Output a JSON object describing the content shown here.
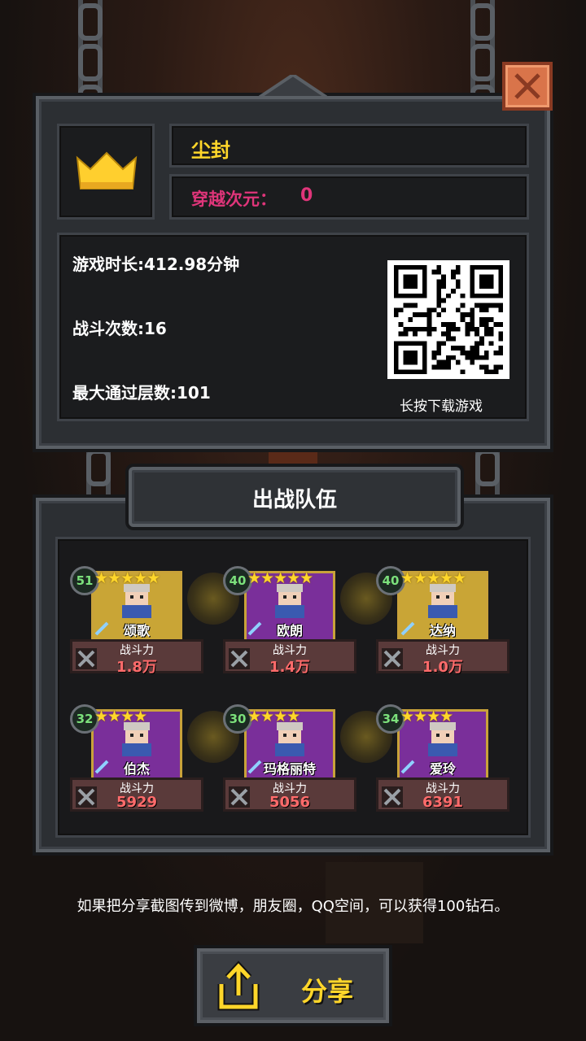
{
  "player": {
    "name": "尘封",
    "dimension_label": "穿越次元：",
    "dimension_value": "0"
  },
  "stats": [
    {
      "label": "游戏时长:",
      "value": "412.98分钟"
    },
    {
      "label": "战斗次数:",
      "value": "16"
    },
    {
      "label": "最大通过层数:",
      "value": "101"
    }
  ],
  "qr_caption": "长按下载游戏",
  "team_title": "出战队伍",
  "heroes": [
    {
      "level": "51",
      "stars": 5,
      "name": "颂歌",
      "power_label": "战斗力",
      "power": "1.8万",
      "card_color": "#c9a536"
    },
    {
      "level": "40",
      "stars": 5,
      "name": "欧朗",
      "power_label": "战斗力",
      "power": "1.4万",
      "card_color": "#7a2f9a"
    },
    {
      "level": "40",
      "stars": 5,
      "name": "达纳",
      "power_label": "战斗力",
      "power": "1.0万",
      "card_color": "#c9a536"
    },
    {
      "level": "32",
      "stars": 4,
      "name": "伯杰",
      "power_label": "战斗力",
      "power": "5929",
      "card_color": "#7a2f9a"
    },
    {
      "level": "30",
      "stars": 4,
      "name": "玛格丽特",
      "power_label": "战斗力",
      "power": "5056",
      "card_color": "#7a2f9a"
    },
    {
      "level": "34",
      "stars": 4,
      "name": "爱玲",
      "power_label": "战斗力",
      "power": "6391",
      "card_color": "#7a2f9a"
    }
  ],
  "share_tip": "如果把分享截图传到微博，朋友圈，QQ空间，可以获得100钻石。",
  "share_label": "分享",
  "colors": {
    "gold": "#ffd62a",
    "pink": "#e0357a",
    "power_red": "#ff6b6b"
  }
}
